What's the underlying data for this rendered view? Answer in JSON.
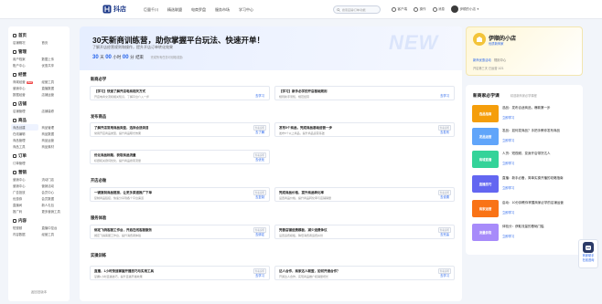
{
  "topbar": {
    "logo_text": "抖店",
    "nav": [
      "巨量千川",
      "精选联盟",
      "电商罗盘",
      "服务市场",
      "学习中心"
    ],
    "search_placeholder": "搜索店铺/订单/功能",
    "actions": [
      {
        "label": "客户端",
        "icon": "monitor-icon"
      },
      {
        "label": "操作",
        "icon": "app-icon"
      },
      {
        "label": "消息",
        "icon": "bell-icon"
      }
    ],
    "user": "伊顺的小店"
  },
  "sidebar": {
    "top_items": [
      {
        "label": "首页",
        "active": false
      }
    ],
    "sections": [
      {
        "title": "首页",
        "items": [
          "店铺概况",
          "首页"
        ]
      },
      {
        "title": "管理",
        "items": [
          "用户档案",
          "数据上传",
          "账户中心",
          "优惠共享"
        ]
      },
      {
        "title": "经营",
        "items": [
          "商城经营",
          "经营工具",
          "营销中心",
          "直播数据",
          "数据经营",
          "店铺运营"
        ]
      },
      {
        "title": "店铺",
        "items": [
          "店铺管理",
          "店铺装修"
        ]
      },
      {
        "title": "商品",
        "items": [
          "商品创建",
          "商品管理",
          "在线编辑",
          "商品数据",
          "商品管理",
          "商品运营",
          "商品工具",
          "商品素材"
        ]
      },
      {
        "title": "订单",
        "items": [
          "订单管理"
        ]
      },
      {
        "title": "营销",
        "items": [
          "营销中心",
          "流动门店",
          "营销中心",
          "营销活动",
          "广告投放",
          "会员中心",
          "优惠券",
          "会员数据",
          "直播间",
          "新人礼包",
          "推广码",
          "更多营销工具"
        ]
      },
      {
        "title": "内容",
        "items": [
          "短视频",
          "直播中控台",
          "内容数据",
          "经营工具"
        ]
      }
    ],
    "new_badge": "NEW",
    "footer": "返回旧版本"
  },
  "hero": {
    "title": "30天新商训练营，助你掌握平台玩法、快速开单！",
    "subtitle": "了解开店经营规则和操作，提升开店订单转化效果",
    "countdown": {
      "days": "30",
      "days_label": "天",
      "hours": "00",
      "hours_label": "小时",
      "minutes": "00",
      "minutes_label": "分",
      "end_label": "结束"
    },
    "note": "完成所有任务可领取奖励",
    "bg_text": "NEW"
  },
  "board": {
    "sections": [
      {
        "title": "新商必学",
        "cards": [
          {
            "title": "【学习】快速了解开店电商相关方式",
            "desc": "开店电商交流和相关知识，了解平台介入一步",
            "action": "去学习"
          },
          {
            "title": "【学习】新手必学的开店基础规则",
            "desc": "规则新手须知，规范经营",
            "action": "去学习"
          }
        ]
      },
      {
        "title": "发布商品",
        "cards": [
          {
            "title": "了解开店常用商品类型，选择合适类目",
            "desc": "常用开店商品类型，提升商品曝光效果",
            "action": "去了解",
            "badge": "查看说明"
          },
          {
            "title": "发布5个商品，完成商品基础运营一步",
            "desc": "发布5个以上商品，提升商品运营基础",
            "action": "去发布",
            "badge": "查看说明"
          },
          {
            "title": "优化商品标题，获取商品流量",
            "desc": "标题和关键词优化，提升商品搜索流量",
            "action": "去优化",
            "badge": "查看说明"
          }
        ]
      },
      {
        "title": "开店必做",
        "cards": [
          {
            "title": "一键复制商品链接，让更多渠道推广下单",
            "desc": "复制商品链接，快速分享到各个平台渠道",
            "action": "去复制",
            "badge": "查看说明"
          },
          {
            "title": "完成商品价格，提升商品转化率",
            "desc": "设置商品价格，提升商品转化率与店铺销量",
            "action": "去设置",
            "badge": "查看说明"
          }
        ]
      },
      {
        "title": "服务体验",
        "cards": [
          {
            "title": "绑定飞鸽客服工作台，开启在线客服服务",
            "desc": "绑定飞鸽客服工作台，提升消费者体验",
            "action": "去绑定",
            "badge": "查看说明"
          },
          {
            "title": "完善店铺运费模板，减少运费争议",
            "desc": "设置运费模板，降低消费者运费纠纷",
            "action": "去完善",
            "badge": "查看说明"
          }
        ]
      },
      {
        "title": "实操训练",
        "cards": [
          {
            "title": "直播，1小时快速掌握开播技巧与实用工具",
            "desc": "掌握1小时直播技巧，提升直播开播效果",
            "action": "去学习",
            "badge": "查看说明"
          },
          {
            "title": "达人合作，商家达人联盟，如何开通合作？",
            "desc": "开通达人合作，实现商品推广和销量增长",
            "action": "去学习",
            "badge": "查看说明"
          }
        ]
      }
    ]
  },
  "shop": {
    "name": "伊顺的小店",
    "tag": "优质新商家",
    "badge1": "新商优惠活动",
    "badge2": "规则中心",
    "info": "开店第三天  已运营 1/21"
  },
  "courses": {
    "title": "新商家必学课",
    "subtitle": "精选新商家必学课程",
    "items": [
      {
        "thumb": "选品指南",
        "color": "#f59e0b",
        "title": "选品：发布合适商品，爆款第一步",
        "action": "立即学习"
      },
      {
        "thumb": "发品运营",
        "color": "#60a5fa",
        "title": "发品：如何发商品？手把手教你发布商品",
        "action": "立即学习"
      },
      {
        "thumb": "商城直播",
        "color": "#34d399",
        "title": "人货：短视频，变身开店带货达人",
        "action": "立即学习"
      },
      {
        "thumb": "直播技巧",
        "color": "#6366f1",
        "title": "直播：新手必备，简单实操开播的攻略指南",
        "action": "立即学习"
      },
      {
        "thumb": "商家运营",
        "color": "#f97316",
        "title": "启动：10分钟教你掌握商家必学的店铺运营",
        "action": "立即学习"
      },
      {
        "thumb": "流量获取",
        "color": "#a78bfa",
        "title": "体验分：获取流量的基础门槛",
        "action": "立即学习"
      }
    ]
  },
  "assistant": {
    "line1": "商家助手",
    "line2": "在线咨询"
  },
  "colors": {
    "accent": "#2563eb",
    "brand": "#1e3a8a"
  }
}
